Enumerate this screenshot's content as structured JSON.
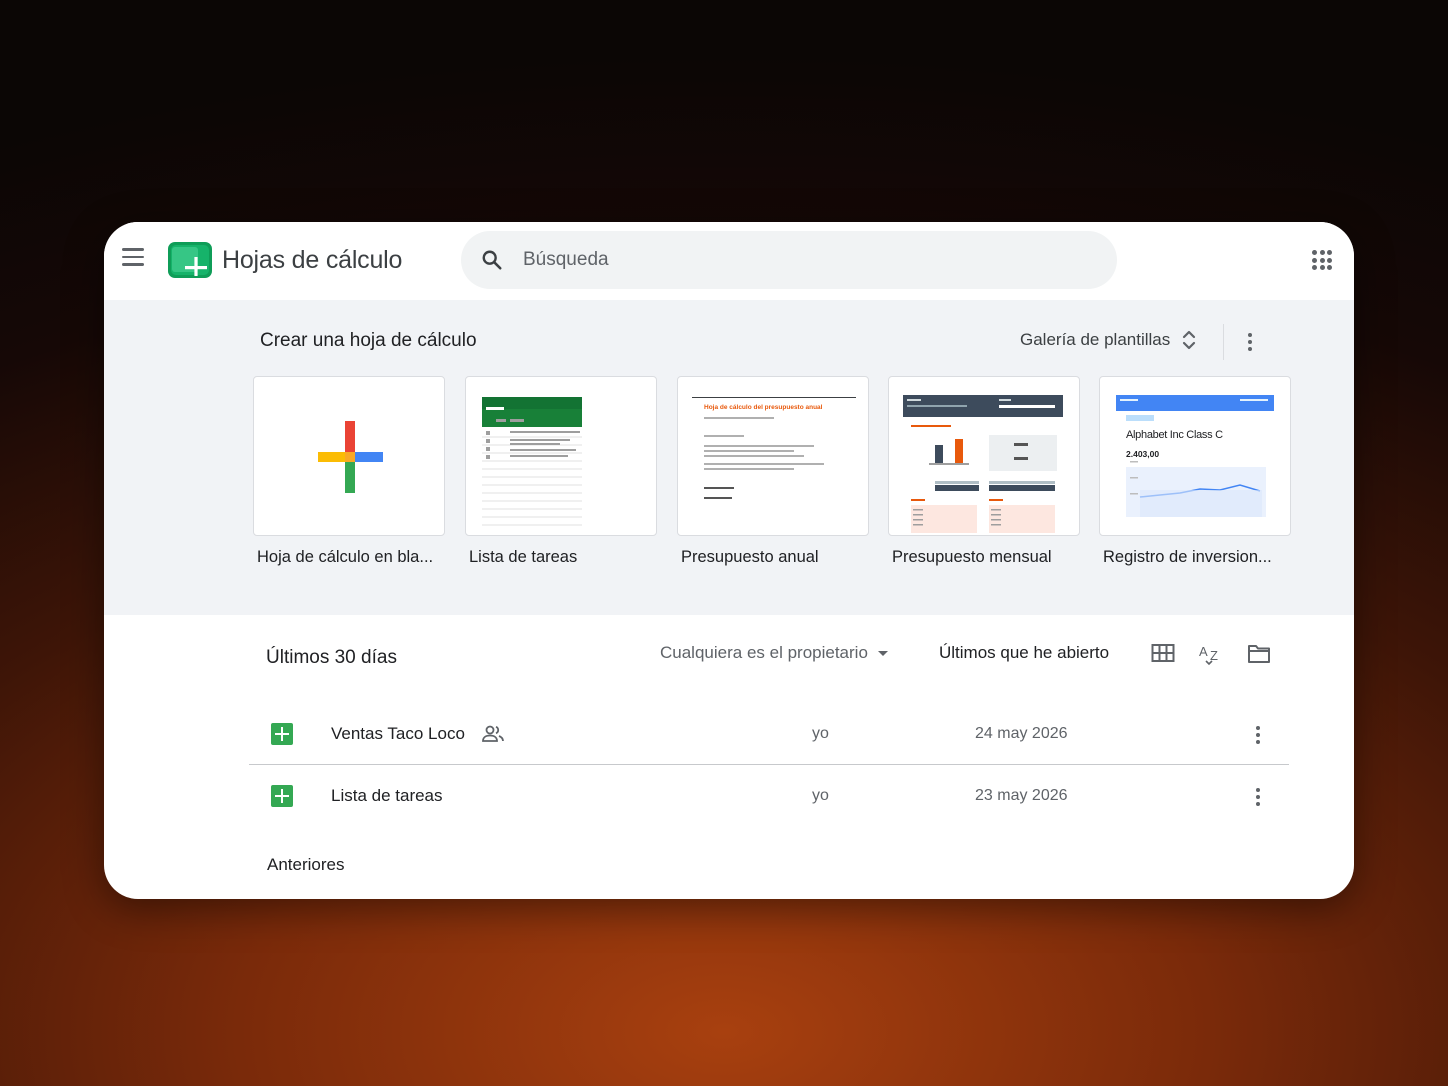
{
  "app": {
    "title": "Hojas de cálculo",
    "logo_icon": "sheets-logo-icon"
  },
  "search": {
    "placeholder": "Búsqueda"
  },
  "templates": {
    "heading": "Crear una hoja de cálculo",
    "gallery_label": "Galería de plantillas",
    "items": [
      {
        "label": "Hoja de cálculo en bla..."
      },
      {
        "label": "Lista de tareas"
      },
      {
        "label": "Presupuesto anual"
      },
      {
        "label": "Presupuesto mensual"
      },
      {
        "label": "Registro de inversion..."
      }
    ],
    "thumbs": {
      "budget_title": "Hoja de cálculo del presupuesto anual",
      "invest_title": "Alphabet Inc Class C",
      "invest_value": "2.403,00"
    }
  },
  "recent": {
    "heading": "Últimos 30 días",
    "owner_filter": "Cualquiera es el propietario",
    "sort_label": "Últimos que he abierto",
    "files": [
      {
        "name": "Ventas Taco Loco",
        "owner": "yo",
        "date": "24 may 2026",
        "shared": true
      },
      {
        "name": "Lista de tareas",
        "owner": "yo",
        "date": "23 may 2026",
        "shared": false
      }
    ],
    "older_heading": "Anteriores"
  },
  "colors": {
    "sheets_green": "#0f9d58",
    "blue": "#4285f4",
    "red": "#ea4335",
    "yellow": "#fbbc04",
    "green": "#34a853"
  }
}
